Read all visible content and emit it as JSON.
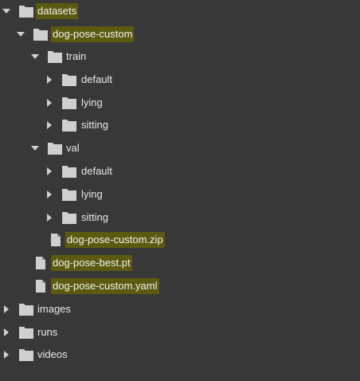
{
  "file_tree": {
    "items": [
      {
        "label": "datasets",
        "type": "folder",
        "expanded": true,
        "highlighted": true
      },
      {
        "label": "dog-pose-custom",
        "type": "folder",
        "expanded": true,
        "highlighted": true
      },
      {
        "label": "train",
        "type": "folder",
        "expanded": true,
        "highlighted": false
      },
      {
        "label": "default",
        "type": "folder",
        "expanded": false,
        "highlighted": false
      },
      {
        "label": "lying",
        "type": "folder",
        "expanded": false,
        "highlighted": false
      },
      {
        "label": "sitting",
        "type": "folder",
        "expanded": false,
        "highlighted": false
      },
      {
        "label": "val",
        "type": "folder",
        "expanded": true,
        "highlighted": false
      },
      {
        "label": "default",
        "type": "folder",
        "expanded": false,
        "highlighted": false
      },
      {
        "label": "lying",
        "type": "folder",
        "expanded": false,
        "highlighted": false
      },
      {
        "label": "sitting",
        "type": "folder",
        "expanded": false,
        "highlighted": false
      },
      {
        "label": "dog-pose-custom.zip",
        "type": "file",
        "highlighted": true
      },
      {
        "label": "dog-pose-best.pt",
        "type": "file",
        "highlighted": true
      },
      {
        "label": "dog-pose-custom.yaml",
        "type": "file",
        "highlighted": true
      },
      {
        "label": "images",
        "type": "folder",
        "expanded": false,
        "highlighted": false
      },
      {
        "label": "runs",
        "type": "folder",
        "expanded": false,
        "highlighted": false
      },
      {
        "label": "videos",
        "type": "folder",
        "expanded": false,
        "highlighted": false
      }
    ]
  },
  "colors": {
    "background": "#383838",
    "highlight": "#5b5a10",
    "icon": "#cfcfcf",
    "text": "#e8e8e8"
  }
}
